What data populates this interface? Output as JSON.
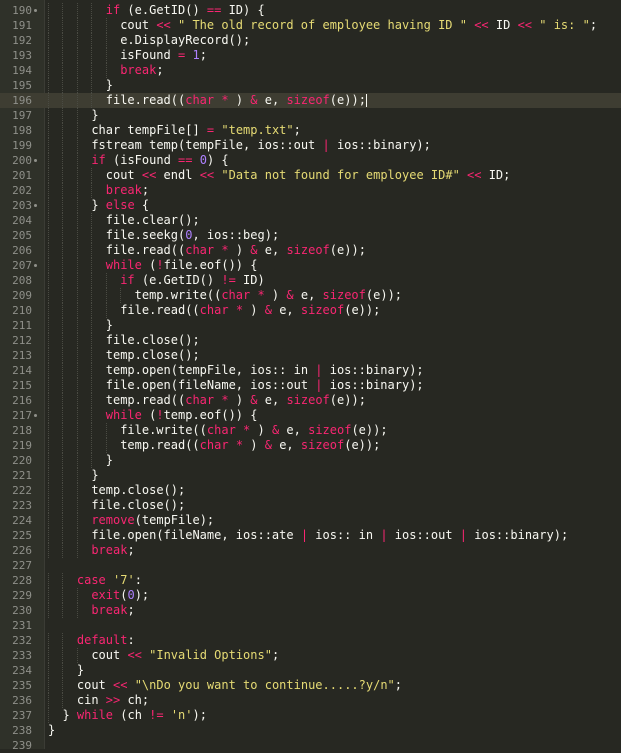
{
  "editor": {
    "theme": "dark",
    "colors": {
      "background": "#272822",
      "text": "#f8f8f2",
      "keyword": "#f92672",
      "string": "#e6db74",
      "number": "#ae81ff",
      "line_number": "#8f908a",
      "current_line": "#3e3d32"
    },
    "current_line": 196,
    "lines": [
      {
        "n": "190",
        "indent": 4,
        "fold": true,
        "t": [
          [
            "kw",
            "if"
          ],
          [
            "pl",
            " (e.GetID() "
          ],
          [
            "op",
            "=="
          ],
          [
            "pl",
            " ID) {"
          ]
        ]
      },
      {
        "n": "191",
        "indent": 5,
        "t": [
          [
            "pl",
            "cout "
          ],
          [
            "op",
            "<<"
          ],
          [
            "str",
            " \" The old record of employee having ID \" "
          ],
          [
            "op",
            "<<"
          ],
          [
            "pl",
            " ID "
          ],
          [
            "op",
            "<<"
          ],
          [
            "str",
            " \" is: \""
          ],
          [
            "pl",
            ";"
          ]
        ]
      },
      {
        "n": "192",
        "indent": 5,
        "t": [
          [
            "pl",
            "e.DisplayRecord();"
          ]
        ]
      },
      {
        "n": "193",
        "indent": 5,
        "t": [
          [
            "pl",
            "isFound "
          ],
          [
            "op",
            "="
          ],
          [
            "pl",
            " "
          ],
          [
            "num",
            "1"
          ],
          [
            "pl",
            ";"
          ]
        ]
      },
      {
        "n": "194",
        "indent": 5,
        "t": [
          [
            "kw",
            "break"
          ],
          [
            "pl",
            ";"
          ]
        ]
      },
      {
        "n": "195",
        "indent": 4,
        "t": [
          [
            "pl",
            "}"
          ]
        ]
      },
      {
        "n": "196",
        "indent": 4,
        "cursor": true,
        "t": [
          [
            "pl",
            "file.read(("
          ],
          [
            "kw",
            "char"
          ],
          [
            "pl",
            " "
          ],
          [
            "op",
            "*"
          ],
          [
            "pl",
            " ) "
          ],
          [
            "op",
            "&"
          ],
          [
            "pl",
            " e, "
          ],
          [
            "kw",
            "sizeof"
          ],
          [
            "pl",
            "(e));"
          ]
        ]
      },
      {
        "n": "197",
        "indent": 3,
        "t": [
          [
            "pl",
            "}"
          ]
        ]
      },
      {
        "n": "198",
        "indent": 3,
        "t": [
          [
            "pl",
            "char tempFile[] "
          ],
          [
            "op",
            "="
          ],
          [
            "pl",
            " "
          ],
          [
            "str",
            "\"temp.txt\""
          ],
          [
            "pl",
            ";"
          ]
        ]
      },
      {
        "n": "199",
        "indent": 3,
        "t": [
          [
            "pl",
            "fstream temp(tempFile, ios::out "
          ],
          [
            "op",
            "|"
          ],
          [
            "pl",
            " ios::binary);"
          ]
        ]
      },
      {
        "n": "200",
        "indent": 3,
        "fold": true,
        "t": [
          [
            "kw",
            "if"
          ],
          [
            "pl",
            " (isFound "
          ],
          [
            "op",
            "=="
          ],
          [
            "pl",
            " "
          ],
          [
            "num",
            "0"
          ],
          [
            "pl",
            ") {"
          ]
        ]
      },
      {
        "n": "201",
        "indent": 4,
        "t": [
          [
            "pl",
            "cout "
          ],
          [
            "op",
            "<<"
          ],
          [
            "pl",
            " endl "
          ],
          [
            "op",
            "<<"
          ],
          [
            "pl",
            " "
          ],
          [
            "str",
            "\"Data not found for employee ID#\""
          ],
          [
            "pl",
            " "
          ],
          [
            "op",
            "<<"
          ],
          [
            "pl",
            " ID;"
          ]
        ]
      },
      {
        "n": "202",
        "indent": 4,
        "t": [
          [
            "kw",
            "break"
          ],
          [
            "pl",
            ";"
          ]
        ]
      },
      {
        "n": "203",
        "indent": 3,
        "fold": true,
        "t": [
          [
            "pl",
            "} "
          ],
          [
            "kw",
            "else"
          ],
          [
            "pl",
            " {"
          ]
        ]
      },
      {
        "n": "204",
        "indent": 4,
        "t": [
          [
            "pl",
            "file.clear();"
          ]
        ]
      },
      {
        "n": "205",
        "indent": 4,
        "t": [
          [
            "pl",
            "file.seekg("
          ],
          [
            "num",
            "0"
          ],
          [
            "pl",
            ", ios::beg);"
          ]
        ]
      },
      {
        "n": "206",
        "indent": 4,
        "t": [
          [
            "pl",
            "file.read(("
          ],
          [
            "kw",
            "char"
          ],
          [
            "pl",
            " "
          ],
          [
            "op",
            "*"
          ],
          [
            "pl",
            " ) "
          ],
          [
            "op",
            "&"
          ],
          [
            "pl",
            " e, "
          ],
          [
            "kw",
            "sizeof"
          ],
          [
            "pl",
            "(e));"
          ]
        ]
      },
      {
        "n": "207",
        "indent": 4,
        "fold": true,
        "t": [
          [
            "kw",
            "while"
          ],
          [
            "pl",
            " ("
          ],
          [
            "op",
            "!"
          ],
          [
            "pl",
            "file.eof()) {"
          ]
        ]
      },
      {
        "n": "208",
        "indent": 5,
        "t": [
          [
            "kw",
            "if"
          ],
          [
            "pl",
            " (e.GetID() "
          ],
          [
            "op",
            "!="
          ],
          [
            "pl",
            " ID)"
          ]
        ]
      },
      {
        "n": "209",
        "indent": 6,
        "t": [
          [
            "pl",
            "temp.write(("
          ],
          [
            "kw",
            "char"
          ],
          [
            "pl",
            " "
          ],
          [
            "op",
            "*"
          ],
          [
            "pl",
            " ) "
          ],
          [
            "op",
            "&"
          ],
          [
            "pl",
            " e, "
          ],
          [
            "kw",
            "sizeof"
          ],
          [
            "pl",
            "(e));"
          ]
        ]
      },
      {
        "n": "210",
        "indent": 5,
        "t": [
          [
            "pl",
            "file.read(("
          ],
          [
            "kw",
            "char"
          ],
          [
            "pl",
            " "
          ],
          [
            "op",
            "*"
          ],
          [
            "pl",
            " ) "
          ],
          [
            "op",
            "&"
          ],
          [
            "pl",
            " e, "
          ],
          [
            "kw",
            "sizeof"
          ],
          [
            "pl",
            "(e));"
          ]
        ]
      },
      {
        "n": "211",
        "indent": 4,
        "t": [
          [
            "pl",
            "}"
          ]
        ]
      },
      {
        "n": "212",
        "indent": 4,
        "t": [
          [
            "pl",
            "file.close();"
          ]
        ]
      },
      {
        "n": "213",
        "indent": 4,
        "t": [
          [
            "pl",
            "temp.close();"
          ]
        ]
      },
      {
        "n": "214",
        "indent": 4,
        "t": [
          [
            "pl",
            "temp.open(tempFile, ios:: in "
          ],
          [
            "op",
            "|"
          ],
          [
            "pl",
            " ios::binary);"
          ]
        ]
      },
      {
        "n": "215",
        "indent": 4,
        "t": [
          [
            "pl",
            "file.open(fileName, ios::out "
          ],
          [
            "op",
            "|"
          ],
          [
            "pl",
            " ios::binary);"
          ]
        ]
      },
      {
        "n": "216",
        "indent": 4,
        "t": [
          [
            "pl",
            "temp.read(("
          ],
          [
            "kw",
            "char"
          ],
          [
            "pl",
            " "
          ],
          [
            "op",
            "*"
          ],
          [
            "pl",
            " ) "
          ],
          [
            "op",
            "&"
          ],
          [
            "pl",
            " e, "
          ],
          [
            "kw",
            "sizeof"
          ],
          [
            "pl",
            "(e));"
          ]
        ]
      },
      {
        "n": "217",
        "indent": 4,
        "fold": true,
        "t": [
          [
            "kw",
            "while"
          ],
          [
            "pl",
            " ("
          ],
          [
            "op",
            "!"
          ],
          [
            "pl",
            "temp.eof()) {"
          ]
        ]
      },
      {
        "n": "218",
        "indent": 5,
        "t": [
          [
            "pl",
            "file.write(("
          ],
          [
            "kw",
            "char"
          ],
          [
            "pl",
            " "
          ],
          [
            "op",
            "*"
          ],
          [
            "pl",
            " ) "
          ],
          [
            "op",
            "&"
          ],
          [
            "pl",
            " e, "
          ],
          [
            "kw",
            "sizeof"
          ],
          [
            "pl",
            "(e));"
          ]
        ]
      },
      {
        "n": "219",
        "indent": 5,
        "t": [
          [
            "pl",
            "temp.read(("
          ],
          [
            "kw",
            "char"
          ],
          [
            "pl",
            " "
          ],
          [
            "op",
            "*"
          ],
          [
            "pl",
            " ) "
          ],
          [
            "op",
            "&"
          ],
          [
            "pl",
            " e, "
          ],
          [
            "kw",
            "sizeof"
          ],
          [
            "pl",
            "(e));"
          ]
        ]
      },
      {
        "n": "220",
        "indent": 4,
        "t": [
          [
            "pl",
            "}"
          ]
        ]
      },
      {
        "n": "221",
        "indent": 3,
        "t": [
          [
            "pl",
            "}"
          ]
        ]
      },
      {
        "n": "222",
        "indent": 3,
        "t": [
          [
            "pl",
            "temp.close();"
          ]
        ]
      },
      {
        "n": "223",
        "indent": 3,
        "t": [
          [
            "pl",
            "file.close();"
          ]
        ]
      },
      {
        "n": "224",
        "indent": 3,
        "t": [
          [
            "kw",
            "remove"
          ],
          [
            "pl",
            "(tempFile);"
          ]
        ]
      },
      {
        "n": "225",
        "indent": 3,
        "t": [
          [
            "pl",
            "file.open(fileName, ios::ate "
          ],
          [
            "op",
            "|"
          ],
          [
            "pl",
            " ios:: in "
          ],
          [
            "op",
            "|"
          ],
          [
            "pl",
            " ios::out "
          ],
          [
            "op",
            "|"
          ],
          [
            "pl",
            " ios::binary);"
          ]
        ]
      },
      {
        "n": "226",
        "indent": 3,
        "t": [
          [
            "kw",
            "break"
          ],
          [
            "pl",
            ";"
          ]
        ]
      },
      {
        "n": "227",
        "indent": 0,
        "t": []
      },
      {
        "n": "228",
        "indent": 2,
        "t": [
          [
            "kw",
            "case"
          ],
          [
            "pl",
            " "
          ],
          [
            "str",
            "'7'"
          ],
          [
            "pl",
            ":"
          ]
        ]
      },
      {
        "n": "229",
        "indent": 3,
        "t": [
          [
            "kw",
            "exit"
          ],
          [
            "pl",
            "("
          ],
          [
            "num",
            "0"
          ],
          [
            "pl",
            ");"
          ]
        ]
      },
      {
        "n": "230",
        "indent": 3,
        "t": [
          [
            "kw",
            "break"
          ],
          [
            "pl",
            ";"
          ]
        ]
      },
      {
        "n": "231",
        "indent": 0,
        "t": []
      },
      {
        "n": "232",
        "indent": 2,
        "t": [
          [
            "kw",
            "default"
          ],
          [
            "pl",
            ":"
          ]
        ]
      },
      {
        "n": "233",
        "indent": 3,
        "t": [
          [
            "pl",
            "cout "
          ],
          [
            "op",
            "<<"
          ],
          [
            "pl",
            " "
          ],
          [
            "str",
            "\"Invalid Options\""
          ],
          [
            "pl",
            ";"
          ]
        ]
      },
      {
        "n": "234",
        "indent": 2,
        "t": [
          [
            "pl",
            "}"
          ]
        ]
      },
      {
        "n": "235",
        "indent": 2,
        "t": [
          [
            "pl",
            "cout "
          ],
          [
            "op",
            "<<"
          ],
          [
            "pl",
            " "
          ],
          [
            "str",
            "\"\\nDo you want to continue.....?y/n\""
          ],
          [
            "pl",
            ";"
          ]
        ]
      },
      {
        "n": "236",
        "indent": 2,
        "t": [
          [
            "pl",
            "cin "
          ],
          [
            "op",
            ">>"
          ],
          [
            "pl",
            " ch;"
          ]
        ]
      },
      {
        "n": "237",
        "indent": 1,
        "t": [
          [
            "pl",
            "} "
          ],
          [
            "kw",
            "while"
          ],
          [
            "pl",
            " (ch "
          ],
          [
            "op",
            "!="
          ],
          [
            "pl",
            " "
          ],
          [
            "str",
            "'n'"
          ],
          [
            "pl",
            ");"
          ]
        ]
      },
      {
        "n": "238",
        "indent": 0,
        "t": [
          [
            "pl",
            "}"
          ]
        ]
      },
      {
        "n": "239",
        "indent": 0,
        "t": []
      }
    ]
  }
}
